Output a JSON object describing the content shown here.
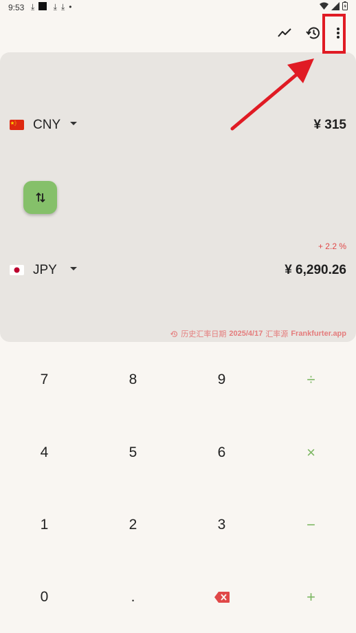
{
  "status_bar": {
    "time": "9:53",
    "icons": [
      "download-icon",
      "square-icon",
      "download-icon",
      "download-icon",
      "dot-icon"
    ],
    "right_icons": [
      "wifi-icon",
      "signal-icon",
      "battery-icon"
    ]
  },
  "toolbar": {
    "buttons": [
      "trend-icon",
      "history-icon",
      "more-vert-icon"
    ]
  },
  "converter": {
    "from": {
      "flag": "china-flag",
      "code": "CNY",
      "amount": "¥ 315"
    },
    "to": {
      "flag": "japan-flag",
      "code": "JPY",
      "amount": "¥ 6,290.26"
    },
    "change": "+ 2.2 %",
    "footnote": {
      "label": "历史汇率日期",
      "date": "2025/4/17",
      "source_label": "汇率源",
      "source": "Frankfurter.app"
    }
  },
  "keypad": [
    [
      "7",
      "8",
      "9",
      "÷"
    ],
    [
      "4",
      "5",
      "6",
      "×"
    ],
    [
      "1",
      "2",
      "3",
      "−"
    ],
    [
      "0",
      ".",
      "⌫",
      "+"
    ]
  ],
  "colors": {
    "background": "#f9f6f2",
    "card": "#e8e5e1",
    "accent_green": "#85c06a",
    "operator_green": "#7bb661",
    "red": "#e04848",
    "annotation_red": "#e01b24"
  }
}
